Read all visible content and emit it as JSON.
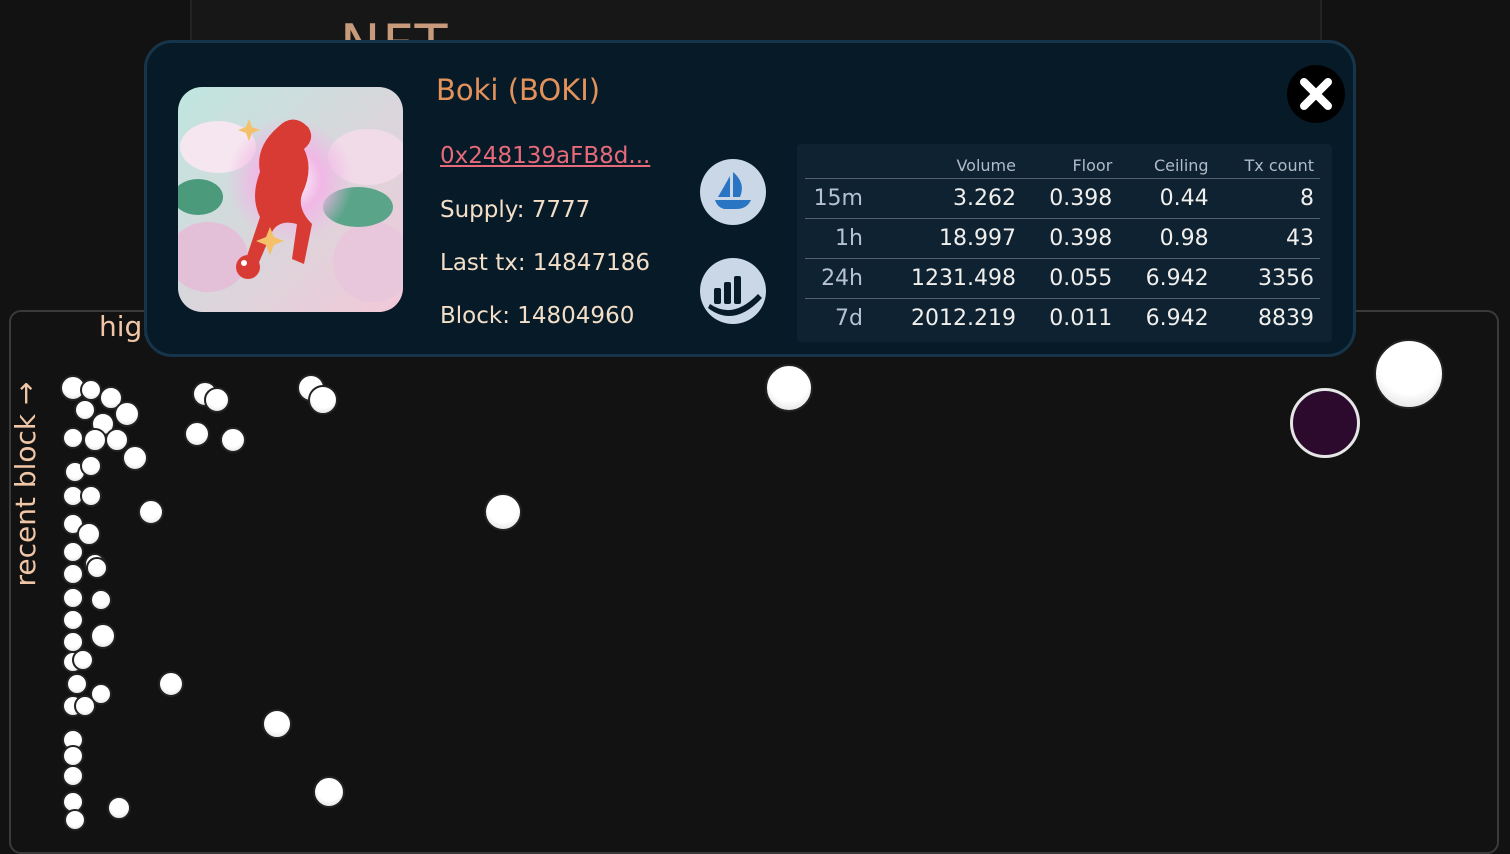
{
  "background": {
    "title": "NFT",
    "plot_heading": "high",
    "axis_label": "recent block →"
  },
  "modal": {
    "collection_name": "Boki (BOKI)",
    "contract_address": "0x248139aFB8d...",
    "supply_label": "Supply: 7777",
    "last_tx_label": "Last tx: 14847186",
    "block_label": "Block: 14804960",
    "opensea_icon": "opensea-sailboat-icon",
    "chart_icon": "bar-chart-icon",
    "close_icon": "close-x-icon",
    "stats": {
      "headers": [
        "",
        "Volume",
        "Floor",
        "Ceiling",
        "Tx count"
      ],
      "rows": [
        {
          "period": "15m",
          "volume": "3.262",
          "floor": "0.398",
          "ceiling": "0.44",
          "tx_count": "8"
        },
        {
          "period": "1h",
          "volume": "18.997",
          "floor": "0.398",
          "ceiling": "0.98",
          "tx_count": "43"
        },
        {
          "period": "24h",
          "volume": "1231.498",
          "floor": "0.055",
          "ceiling": "6.942",
          "tx_count": "3356"
        },
        {
          "period": "7d",
          "volume": "2012.219",
          "floor": "0.011",
          "ceiling": "6.942",
          "tx_count": "8839"
        }
      ]
    }
  },
  "colors": {
    "modal_bg": "#071a28",
    "accent_orange": "#e2925a",
    "link_pink": "#e66a7a",
    "icon_blue": "#2a74c4"
  }
}
